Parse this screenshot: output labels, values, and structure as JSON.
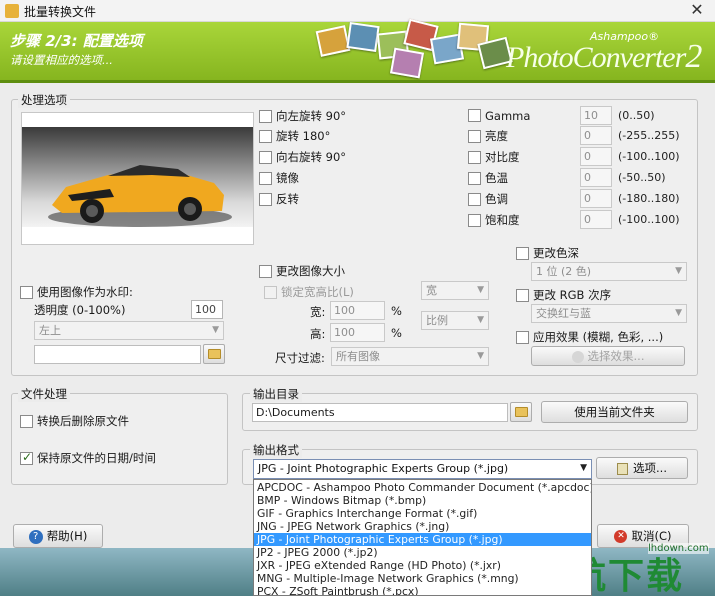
{
  "window": {
    "title": "批量转换文件",
    "close_glyph": "✕"
  },
  "banner": {
    "step_title": "步骤 2/3: 配置选项",
    "step_subtitle": "请设置相应的选项...",
    "logo_small": "Ashampoo®",
    "logo_big": "PhotoConverter",
    "logo_version": "2"
  },
  "processing": {
    "label": "处理选项",
    "rotate_left": "向左旋转 90°",
    "rotate_180": "旋转 180°",
    "rotate_right": "向右旋转 90°",
    "mirror": "镜像",
    "flip": "反转",
    "adjust": [
      {
        "label": "Gamma",
        "value": "10",
        "range": "(0..50)"
      },
      {
        "label": "亮度",
        "value": "0",
        "range": "(-255..255)"
      },
      {
        "label": "对比度",
        "value": "0",
        "range": "(-100..100)"
      },
      {
        "label": "色温",
        "value": "0",
        "range": "(-50..50)"
      },
      {
        "label": "色调",
        "value": "0",
        "range": "(-180..180)"
      },
      {
        "label": "饱和度",
        "value": "0",
        "range": "(-100..100)"
      }
    ],
    "watermark": {
      "label": "使用图像作为水印:",
      "opacity_label": "透明度 (0-100%)",
      "opacity_value": "100",
      "position": "左上"
    },
    "resize": {
      "label": "更改图像大小",
      "lock_label": "锁定宽高比(L)",
      "unit_top": "宽",
      "width_label": "宽:",
      "width_value": "100",
      "width_unit": "%",
      "height_label": "高:",
      "height_value": "100",
      "height_unit": "%",
      "unit_bottom": "比例",
      "filter_label": "尺寸过滤:",
      "filter_value": "所有图像"
    },
    "color_depth": {
      "label": "更改色深",
      "value": "1 位 (2 色)"
    },
    "rgb_order": {
      "label": "更改 RGB 次序",
      "value": "交换红与蓝"
    },
    "effects": {
      "label": "应用效果 (模糊, 色彩, ...)",
      "button": "选择效果..."
    }
  },
  "file_handling": {
    "label": "文件处理",
    "delete_label": "转换后删除原文件",
    "keep_date_label": "保持原文件的日期/时间"
  },
  "output_dir": {
    "label": "输出目录",
    "value": "D:\\Documents",
    "use_current": "使用当前文件夹"
  },
  "output_format": {
    "label": "输出格式",
    "selected": "JPG - Joint Photographic Experts Group (*.jpg)",
    "options_button": "选项...",
    "options": [
      "APCDOC - Ashampoo Photo Commander Document (*.apcdoc)",
      "BMP - Windows Bitmap (*.bmp)",
      "GIF - Graphics Interchange Format (*.gif)",
      "JNG - JPEG Network Graphics (*.jng)",
      "JPG - Joint Photographic Experts Group (*.jpg)",
      "JP2 - JPEG 2000 (*.jp2)",
      "JXR - JPEG eXtended Range (HD Photo) (*.jxr)",
      "MNG - Multiple-Image Network Graphics (*.mng)",
      "PCX - ZSoft Paintbrush (*.pcx)"
    ],
    "selected_index": 4
  },
  "footer": {
    "help": "帮助(H)",
    "cancel": "取消(C)",
    "watermark_site": "lhdown.com",
    "watermark_text": "领航下载"
  }
}
